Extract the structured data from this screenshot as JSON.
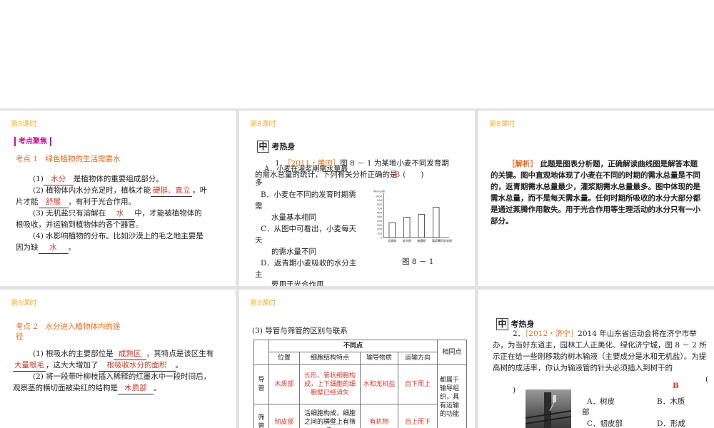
{
  "header": "第8课时",
  "slide1": {
    "box": "考点聚焦",
    "point_title": "考点 1　绿色植物的生活需要水",
    "l1a": "(1)",
    "b1": "水分",
    "l1b": "是植物体的重要组成部分。",
    "l2a": "(2) 植物体内水分充足时，植株才能",
    "b2": "硬挺、直立",
    "l2b": "，叶",
    "l3a": "片才能",
    "b3": "舒展",
    "l3b": "，有利于光合作用。",
    "l4a": "(3) 无机盐只有溶解在",
    "b4": "水",
    "l4b": "中，才能被植物体的",
    "l5": "根吸收，并运输到植物体的各个器官。",
    "l6": "(4) 水影响植物的分布。比如沙漠上的毛之地主要是",
    "l7a": "因为缺",
    "b5": "水",
    "l7b": "。"
  },
  "slide2": {
    "title": "考热身",
    "zhong": "中",
    "q1": "1．",
    "q1_src": "［2011・莆田］",
    "q1_text": "图 8 － 1 为某地小麦不同发育期",
    "q1_l2": "的需水总量的统计，下列有关分析正确的是",
    "q1_ans": "B",
    "q1_paren": "(　　)",
    "optA": "A．小麦在灌浆期需水量最",
    "optA2": "多",
    "optB": "B．小麦在不同的发育时期需",
    "optB2": "水量基本相同",
    "optC": "C．从图中可看出，小麦每天",
    "optC2": "的需水量不同",
    "optD": "D．返青期小麦吸收的水分主",
    "optD2": "要用于光合作用",
    "fig_caption": "图 8 － 1"
  },
  "slide3": {
    "label": "［解析］",
    "text": "此题是图表分析题，正确解读曲线图是解答本题的关键。图中直观地体现了小麦在不同的时期的需水总量是不同的，返青期需水总量最少，灌浆期需水总量最多。图中体现的是需水总量，而不是每天需水量。任何时期所吸收的水分大部分都是通过蒸腾作用散失。用于光合作用等生理活动的水分只有一小部分。"
  },
  "slide4": {
    "point_title_1": "考点 2　水分进入植物体内的途",
    "point_title_2": "径",
    "l1a": "(1) 根吸水的主要部位是",
    "b1": "成熟区",
    "l1b": "，其特点是该区生有",
    "b2": "大量根毛",
    "l2a": "，这大大增加了",
    "b3": "根吸收水分的面积",
    "l2b": "。",
    "l3": "(2) 将一段带叶柳枝插入稀释的红墨水中一段时间后，",
    "l4a": "观察茎的横切面被染红的结构是",
    "b4": "木质部",
    "l4b": "。"
  },
  "slide5": {
    "title": "(3) 导管与筛管的区别与联系",
    "th_diff": "不同点",
    "th_pos": "位置",
    "th_struct": "细胞结构特点",
    "th_sub": "输导物质",
    "th_dir": "运输方向",
    "th_same": "相同点",
    "r1_name": "导管",
    "r1_pos": "木质部",
    "r1_struct": "长形、管状细胞构成，上下细胞的细胞壁已经消失",
    "r1_sub": "水和无机盐",
    "r1_dir": "自下而上",
    "same": "都属于输导组织，具有运输的功能",
    "r2_name": "筛管",
    "r2_pos": "韧皮部",
    "r2_struct": "活细胞构成，细胞之间的横壁上有筛孔",
    "r2_sub": "有机物",
    "r2_dir": "自上而下"
  },
  "slide6": {
    "zhong": "中",
    "title": "考热身",
    "q2": "2．",
    "q2_src": "［2012・济宁］",
    "q2_text": "2014 年山东省运动会将在济宁市举办，为当好东道主，园林工人正美化、绿化济宁城，图 8 － 2 所示正在给一些刚移栽的树木输液（主要成分是水和无机盐）。为提高树的成活率，你认为输液管的针头必须插入到树干的",
    "q2_paren_l": "(",
    "q2_paren_r": ")",
    "q2_ans": "B",
    "optA": "A．树皮",
    "optB": "B．木质部",
    "optB_l1": "B．木质",
    "optB_l2": "部",
    "optC": "C．韧皮部",
    "optD": "D．形成"
  },
  "chart_data": {
    "type": "bar",
    "ylabel": "需水总量",
    "xlabel": "不同发育期",
    "categories": [
      "返青期",
      "拔节期",
      "抽穗期",
      "灌浆期"
    ],
    "values": [
      360,
      490,
      560,
      730
    ],
    "ylim": [
      0,
      1000
    ],
    "yticks": [
      0,
      100,
      200,
      300,
      400,
      500,
      600,
      700,
      800,
      900,
      1000
    ]
  }
}
